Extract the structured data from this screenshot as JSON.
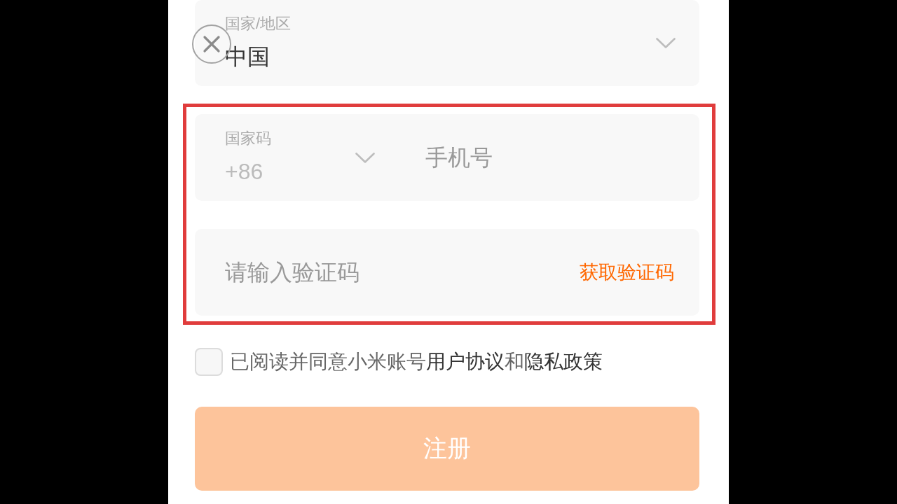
{
  "country_field": {
    "label": "国家/地区",
    "value": "中国"
  },
  "phone_form": {
    "highlighted": true,
    "phone_field": {
      "code_label": "国家码",
      "code_value": "+86",
      "placeholder": "手机号"
    },
    "code_field": {
      "placeholder": "请输入验证码",
      "action": "获取验证码"
    }
  },
  "agreement": {
    "checked": false,
    "parts": [
      {
        "kind": "text",
        "text": "已阅读并同意小米账号"
      },
      {
        "kind": "link",
        "text": "用户协议"
      },
      {
        "kind": "text",
        "text": "和"
      },
      {
        "kind": "link",
        "text": "隐私政策"
      }
    ]
  },
  "submit_button": {
    "label": "注册",
    "disabled": true
  }
}
